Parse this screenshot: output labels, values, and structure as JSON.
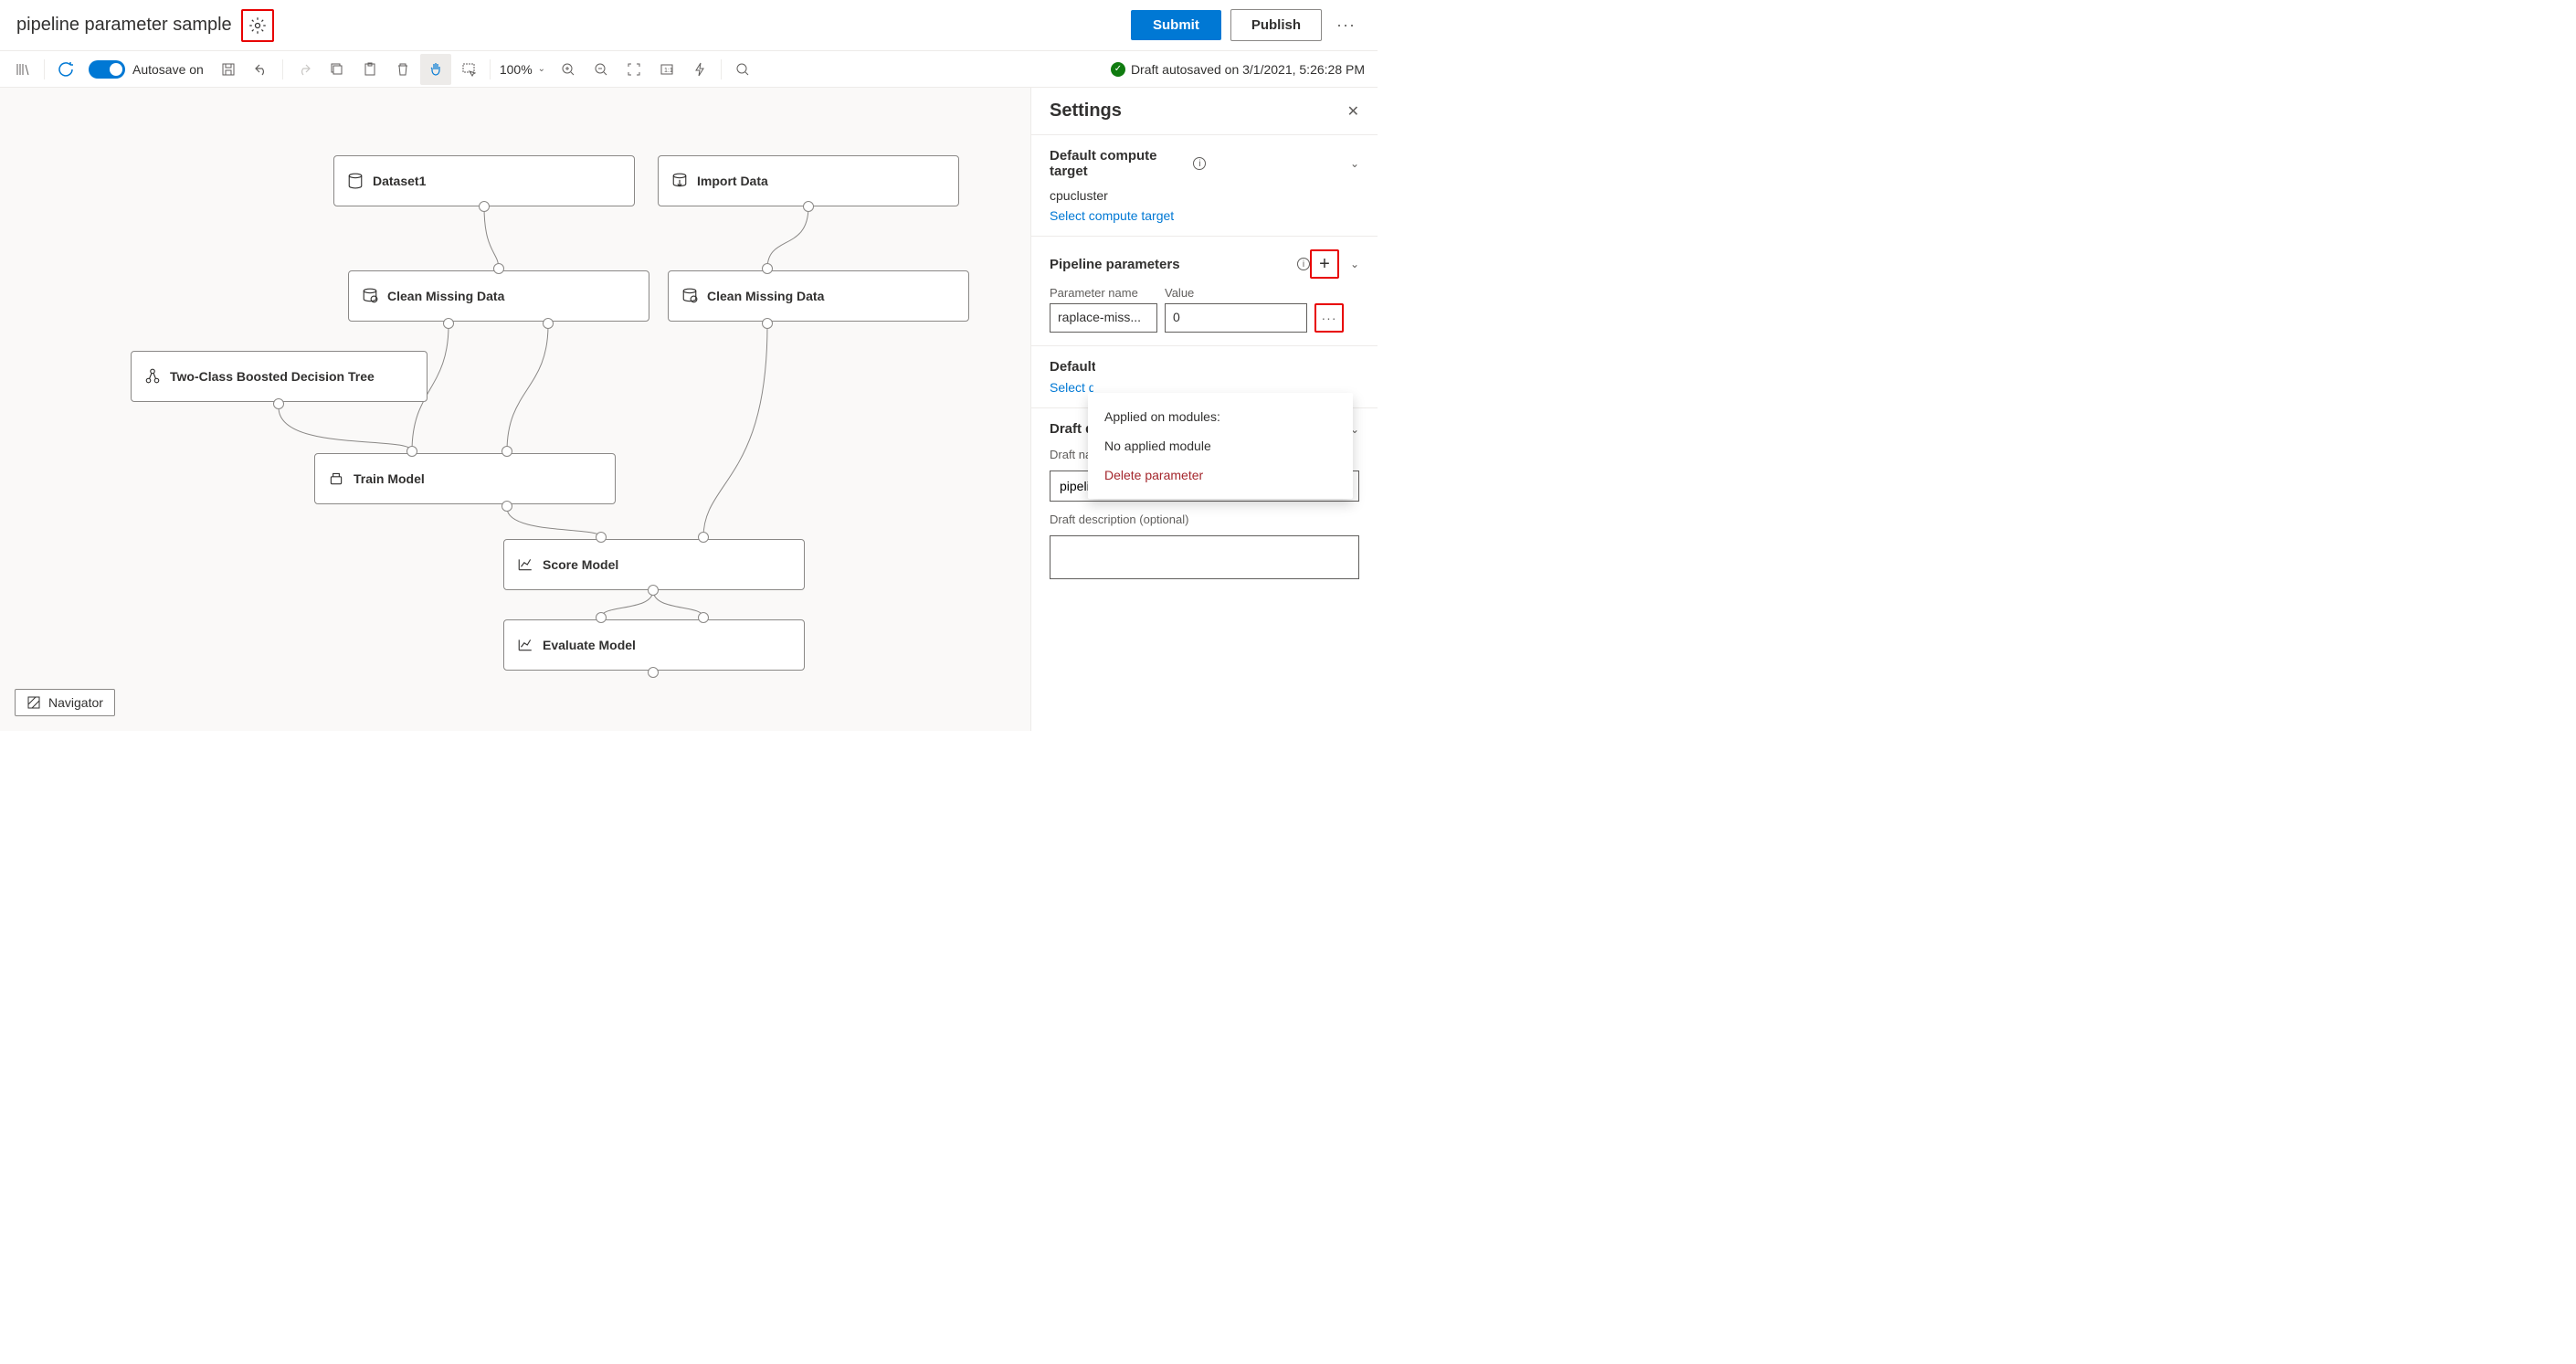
{
  "header": {
    "title": "pipeline parameter sample",
    "submit": "Submit",
    "publish": "Publish"
  },
  "toolbar": {
    "autosave_label": "Autosave on",
    "zoom": "100%",
    "status": "Draft autosaved on 3/1/2021, 5:26:28 PM"
  },
  "nodes": {
    "dataset1": "Dataset1",
    "import_data": "Import Data",
    "clean_missing_1": "Clean Missing Data",
    "clean_missing_2": "Clean Missing Data",
    "boosted_tree": "Two-Class Boosted Decision Tree",
    "train_model": "Train Model",
    "score_model": "Score Model",
    "evaluate_model": "Evaluate Model"
  },
  "navigator": "Navigator",
  "settings": {
    "title": "Settings",
    "default_compute": {
      "heading": "Default compute target",
      "value": "cpucluster",
      "link": "Select compute target"
    },
    "pipeline_params": {
      "heading": "Pipeline parameters",
      "name_label": "Parameter name",
      "value_label": "Value",
      "param_name": "raplace-miss...",
      "param_value": "0"
    },
    "default_datastore": {
      "heading_cut": "Default",
      "link_cut": "Select d"
    },
    "draft": {
      "heading": "Draft details",
      "name_label": "Draft name",
      "name_value": "pipeline parameter sample",
      "desc_label": "Draft description (optional)"
    }
  },
  "flyout": {
    "applied_heading": "Applied on modules:",
    "no_applied": "No applied module",
    "delete": "Delete parameter"
  }
}
